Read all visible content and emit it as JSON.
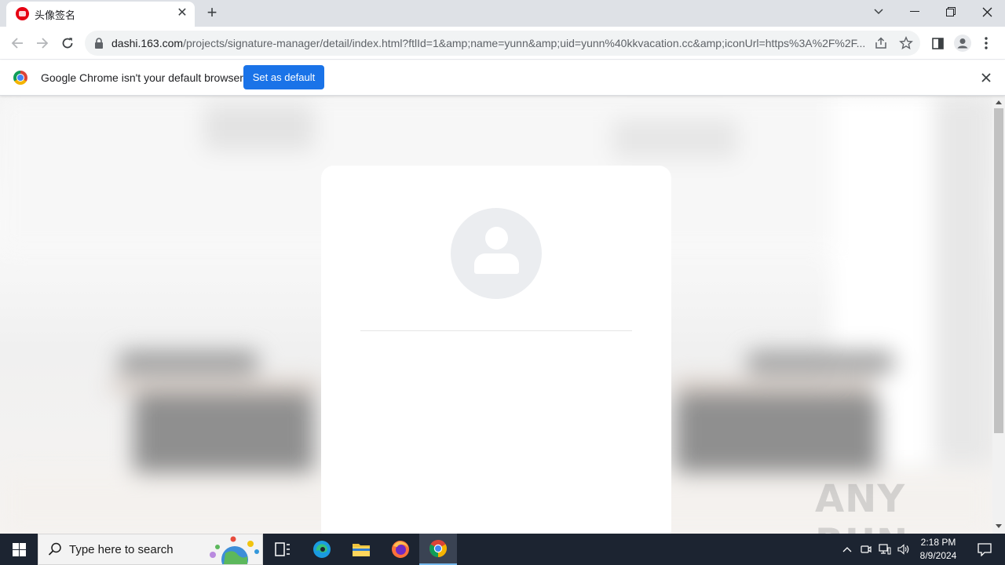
{
  "browser": {
    "tab": {
      "title": "头像签名",
      "favicon": "netease-dashi-icon"
    },
    "url": {
      "host": "dashi.163.com",
      "path": "/projects/signature-manager/detail/index.html?ftlId=1&amp;name=yunn&amp;uid=yunn%40kkvacation.cc&amp;iconUrl=https%3A%2F%2F..."
    },
    "infobar": {
      "message": "Google Chrome isn't your default browser",
      "button": "Set as default"
    }
  },
  "page": {
    "card": {
      "avatar": "user-placeholder-icon"
    }
  },
  "watermark": "ANY RUN",
  "taskbar": {
    "search_placeholder": "Type here to search",
    "time": "2:18 PM",
    "date": "8/9/2024"
  },
  "colors": {
    "accent": "#1a73e8",
    "taskbar": "#1c2431",
    "tab_strip": "#dee1e6",
    "avatar_bg": "#ebedf0"
  }
}
